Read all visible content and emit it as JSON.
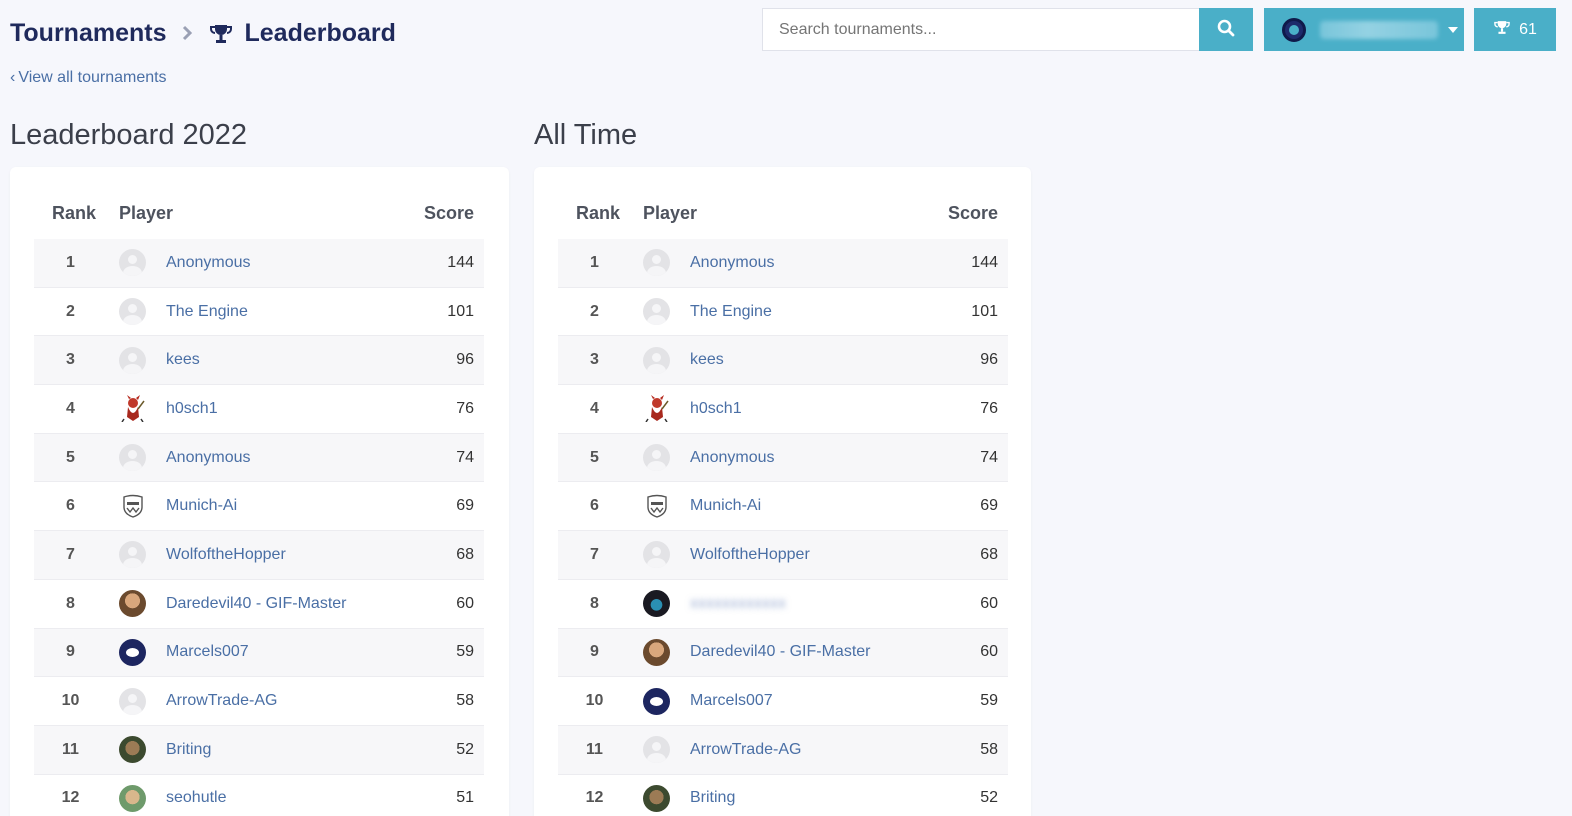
{
  "breadcrumb": {
    "root": "Tournaments",
    "current": "Leaderboard"
  },
  "back_link": "View all tournaments",
  "search": {
    "placeholder": "Search tournaments..."
  },
  "trophy_count": "61",
  "colors": {
    "accent": "#4aafc8",
    "link": "#4a6fa5",
    "brand_dark": "#1f2a5c"
  },
  "headers": {
    "rank": "Rank",
    "player": "Player",
    "score": "Score"
  },
  "panels": [
    {
      "title": "Leaderboard 2022",
      "rows": [
        {
          "rank": "1",
          "player": "Anonymous",
          "score": "144",
          "avatar": "default-avatar"
        },
        {
          "rank": "2",
          "player": "The Engine",
          "score": "101",
          "avatar": "default-avatar"
        },
        {
          "rank": "3",
          "player": "kees",
          "score": "96",
          "avatar": "default-avatar"
        },
        {
          "rank": "4",
          "player": "h0sch1",
          "score": "76",
          "avatar": "devil-avatar"
        },
        {
          "rank": "5",
          "player": "Anonymous",
          "score": "74",
          "avatar": "default-avatar"
        },
        {
          "rank": "6",
          "player": "Munich-Ai",
          "score": "69",
          "avatar": "crest-avatar"
        },
        {
          "rank": "7",
          "player": "WolfoftheHopper",
          "score": "68",
          "avatar": "default-avatar"
        },
        {
          "rank": "8",
          "player": "Daredevil40 - GIF-Master",
          "score": "60",
          "avatar": "photo-avatar"
        },
        {
          "rank": "9",
          "player": "Marcels007",
          "score": "59",
          "avatar": "navy-logo-avatar"
        },
        {
          "rank": "10",
          "player": "ArrowTrade-AG",
          "score": "58",
          "avatar": "default-avatar"
        },
        {
          "rank": "11",
          "player": "Briting",
          "score": "52",
          "avatar": "photo-avatar-2"
        },
        {
          "rank": "12",
          "player": "seohutle",
          "score": "51",
          "avatar": "photo-avatar-3"
        }
      ]
    },
    {
      "title": "All Time",
      "rows": [
        {
          "rank": "1",
          "player": "Anonymous",
          "score": "144",
          "avatar": "default-avatar"
        },
        {
          "rank": "2",
          "player": "The Engine",
          "score": "101",
          "avatar": "default-avatar"
        },
        {
          "rank": "3",
          "player": "kees",
          "score": "96",
          "avatar": "default-avatar"
        },
        {
          "rank": "4",
          "player": "h0sch1",
          "score": "76",
          "avatar": "devil-avatar"
        },
        {
          "rank": "5",
          "player": "Anonymous",
          "score": "74",
          "avatar": "default-avatar"
        },
        {
          "rank": "6",
          "player": "Munich-Ai",
          "score": "69",
          "avatar": "crest-avatar"
        },
        {
          "rank": "7",
          "player": "WolfoftheHopper",
          "score": "68",
          "avatar": "default-avatar"
        },
        {
          "rank": "8",
          "player": "",
          "score": "60",
          "avatar": "dark-avatar",
          "blurred": true
        },
        {
          "rank": "9",
          "player": "Daredevil40 - GIF-Master",
          "score": "60",
          "avatar": "photo-avatar"
        },
        {
          "rank": "10",
          "player": "Marcels007",
          "score": "59",
          "avatar": "navy-logo-avatar"
        },
        {
          "rank": "11",
          "player": "ArrowTrade-AG",
          "score": "58",
          "avatar": "default-avatar"
        },
        {
          "rank": "12",
          "player": "Briting",
          "score": "52",
          "avatar": "photo-avatar-2"
        }
      ]
    }
  ]
}
